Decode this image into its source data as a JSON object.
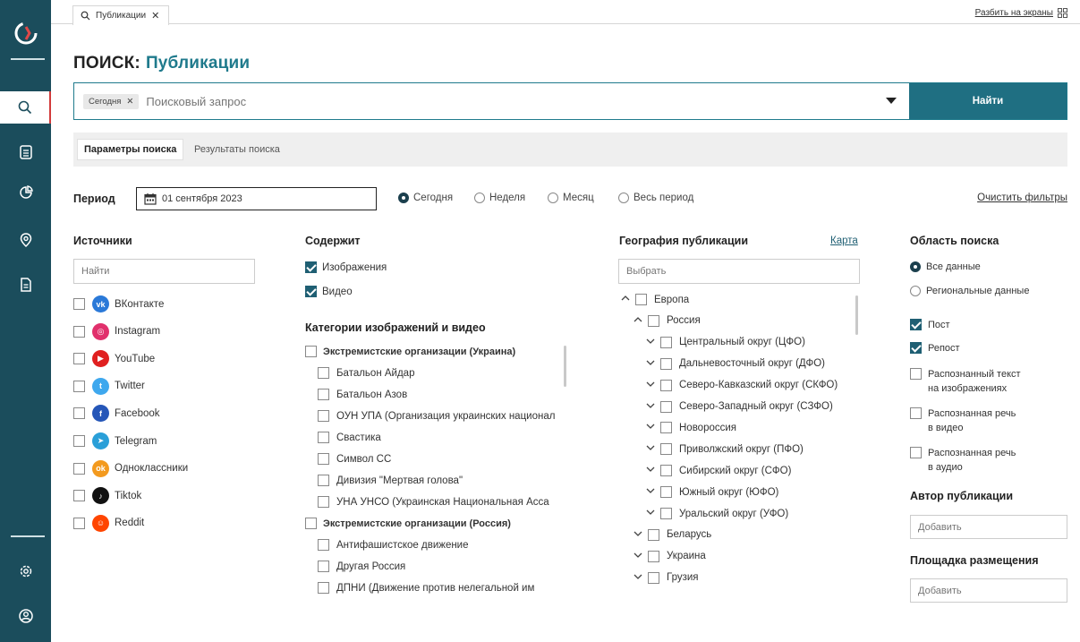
{
  "tab": {
    "label": "Публикации",
    "close": "✕"
  },
  "split_screens": "Разбить на экраны",
  "title": {
    "prefix": "ПОИСК:",
    "section": "Публикации"
  },
  "search": {
    "chip": "Сегодня",
    "chip_close": "✕",
    "placeholder": "Поисковый запрос",
    "button": "Найти"
  },
  "subtabs": [
    "Параметры поиска",
    "Результаты поиска"
  ],
  "period": {
    "label": "Период",
    "date": "01 сентября  2023",
    "options": [
      {
        "label": "Сегодня",
        "selected": true
      },
      {
        "label": "Неделя",
        "selected": false
      },
      {
        "label": "Месяц",
        "selected": false
      },
      {
        "label": "Весь период",
        "selected": false
      }
    ],
    "clear": "Очистить фильтры"
  },
  "sources": {
    "title": "Источники",
    "placeholder": "Найти",
    "items": [
      {
        "label": "ВКонтакте",
        "icon": "vk-icon",
        "color": "#2a79d8",
        "glyph": "vk"
      },
      {
        "label": "Instagram",
        "icon": "instagram-icon",
        "color": "#e1306c",
        "glyph": "◎"
      },
      {
        "label": "YouTube",
        "icon": "youtube-icon",
        "color": "#e02020",
        "glyph": "▶"
      },
      {
        "label": "Twitter",
        "icon": "twitter-icon",
        "color": "#3ea8ee",
        "glyph": "t"
      },
      {
        "label": "Facebook",
        "icon": "facebook-icon",
        "color": "#2556b8",
        "glyph": "f"
      },
      {
        "label": "Telegram",
        "icon": "telegram-icon",
        "color": "#2a9fd8",
        "glyph": "➤"
      },
      {
        "label": "Одноклассники",
        "icon": "odnoklassniki-icon",
        "color": "#f39a1e",
        "glyph": "ok"
      },
      {
        "label": "Tiktok",
        "icon": "tiktok-icon",
        "color": "#111111",
        "glyph": "♪"
      },
      {
        "label": "Reddit",
        "icon": "reddit-icon",
        "color": "#ff4500",
        "glyph": "☺"
      }
    ]
  },
  "contains": {
    "title": "Содержит",
    "items": [
      {
        "label": "Изображения",
        "checked": true
      },
      {
        "label": "Видео",
        "checked": true
      }
    ]
  },
  "categories": {
    "title": "Категории изображений и видео",
    "groups": [
      {
        "label": "Экстремистские организации (Украина)",
        "children": [
          "Батальон Айдар",
          "Батальон Азов",
          "ОУН УПА (Организация украинских национал",
          "Свастика",
          "Символ СС",
          "Дивизия \"Мертвая голова\"",
          "УНА УНСО (Украинская Национальная Асса"
        ]
      },
      {
        "label": "Экстремистские организации (Россия)",
        "children": [
          "Антифашистское движение",
          "Другая Россия",
          "ДПНИ (Движение против нелегальной им"
        ]
      }
    ]
  },
  "geo": {
    "title": "География публикации",
    "map": "Карта",
    "placeholder": "Выбрать",
    "items": [
      {
        "label": "Европа",
        "level": 0,
        "chev": "^"
      },
      {
        "label": "Россия",
        "level": 1,
        "chev": "^"
      },
      {
        "label": "Центральный округ (ЦФО)",
        "level": 2,
        "chev": "v"
      },
      {
        "label": "Дальневосточный округ (ДФО)",
        "level": 2,
        "chev": "v"
      },
      {
        "label": "Северо-Кавказский округ (СКФО)",
        "level": 2,
        "chev": "v"
      },
      {
        "label": "Северо-Западный округ (СЗФО)",
        "level": 2,
        "chev": "v"
      },
      {
        "label": "Новороссия",
        "level": 2,
        "chev": "v"
      },
      {
        "label": "Приволжский округ (ПФО)",
        "level": 2,
        "chev": "v"
      },
      {
        "label": "Сибирский округ (СФО)",
        "level": 2,
        "chev": "v"
      },
      {
        "label": "Южный округ (ЮФО)",
        "level": 2,
        "chev": "v"
      },
      {
        "label": "Уральский округ (УФО)",
        "level": 2,
        "chev": "v"
      },
      {
        "label": "Беларусь",
        "level": 1,
        "chev": "v"
      },
      {
        "label": "Украина",
        "level": 1,
        "chev": "v"
      },
      {
        "label": "Грузия",
        "level": 1,
        "chev": "v"
      }
    ]
  },
  "scope": {
    "title": "Область поиска",
    "radios": [
      {
        "label": "Все данные",
        "selected": true
      },
      {
        "label": "Региональные данные",
        "selected": false
      }
    ],
    "checks": [
      {
        "label": "Пост",
        "checked": true
      },
      {
        "label": "Репост",
        "checked": true
      },
      {
        "line1": "Распознанный текст",
        "line2": "на изображениях",
        "checked": false
      },
      {
        "line1": "Распознанная речь",
        "line2": "в видео",
        "checked": false
      },
      {
        "line1": "Распознанная речь",
        "line2": "в аудио",
        "checked": false
      }
    ]
  },
  "author": {
    "title": "Автор публикации",
    "placeholder": "Добавить"
  },
  "platform": {
    "title": "Площадка размещения",
    "placeholder": "Добавить"
  }
}
